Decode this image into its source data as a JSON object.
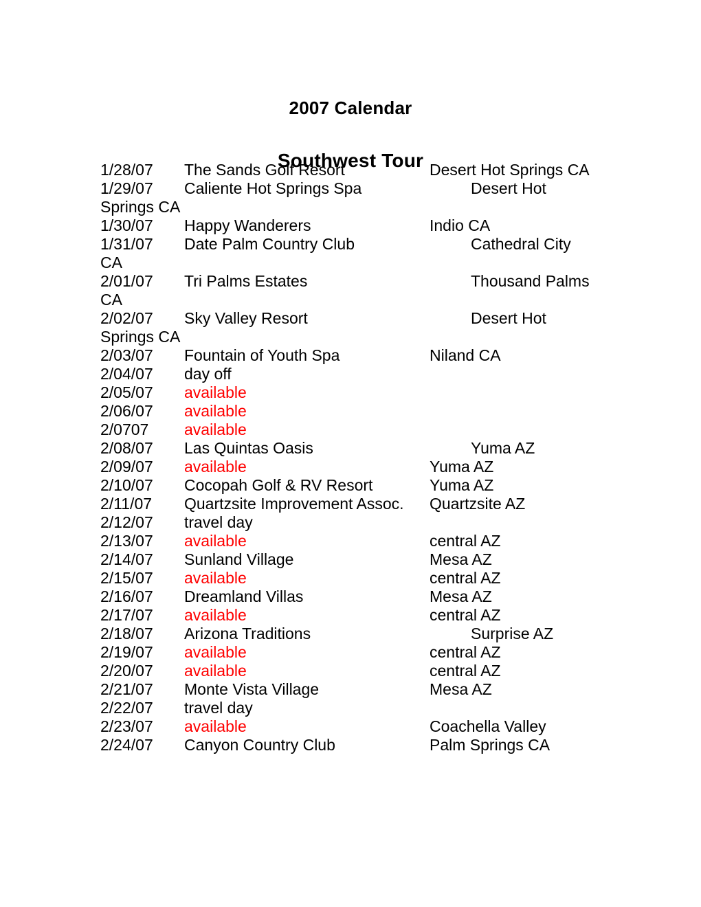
{
  "document": {
    "title": "2007 Calendar",
    "subtitle": "Southwest Tour"
  },
  "colors": {
    "available": "#ff0000",
    "text": "#000000",
    "background": "#ffffff"
  },
  "schedule": {
    "rows": [
      {
        "date": "1/28/07",
        "description": "The Sands Golf Resort",
        "available": false,
        "location": "Desert Hot Springs CA",
        "location_indent": 479,
        "wrap": ""
      },
      {
        "date": "1/29/07",
        "description": "Caliente Hot Springs Spa",
        "available": false,
        "location": "Desert Hot",
        "location_indent": 539,
        "wrap": "Springs CA"
      },
      {
        "date": "1/30/07",
        "description": "Happy Wanderers",
        "available": false,
        "location": "Indio CA",
        "location_indent": 479,
        "wrap": ""
      },
      {
        "date": "1/31/07",
        "description": "Date Palm Country Club",
        "available": false,
        "location": "Cathedral City",
        "location_indent": 539,
        "wrap": "CA"
      },
      {
        "date": "2/01/07",
        "description": "Tri Palms Estates",
        "available": false,
        "location": "Thousand Palms",
        "location_indent": 539,
        "wrap": "CA"
      },
      {
        "date": "2/02/07",
        "description": "Sky Valley Resort",
        "available": false,
        "location": "Desert Hot",
        "location_indent": 539,
        "wrap": "Springs CA"
      },
      {
        "date": "2/03/07",
        "description": "Fountain of Youth Spa",
        "available": false,
        "location": "Niland CA",
        "location_indent": 479,
        "wrap": ""
      },
      {
        "date": "2/04/07",
        "description": "day off",
        "available": false,
        "location": "",
        "location_indent": 479,
        "wrap": ""
      },
      {
        "date": "2/05/07",
        "description": "available",
        "available": true,
        "location": "",
        "location_indent": 479,
        "wrap": ""
      },
      {
        "date": "2/06/07",
        "description": "available",
        "available": true,
        "location": "",
        "location_indent": 479,
        "wrap": ""
      },
      {
        "date": "2/0707",
        "description": "available",
        "available": true,
        "location": "",
        "location_indent": 479,
        "wrap": ""
      },
      {
        "date": "2/08/07",
        "description": "Las Quintas Oasis",
        "available": false,
        "location": "Yuma AZ",
        "location_indent": 539,
        "wrap": ""
      },
      {
        "date": "2/09/07",
        "description": "available",
        "available": true,
        "location": "Yuma AZ",
        "location_indent": 479,
        "wrap": ""
      },
      {
        "date": "2/10/07",
        "description": "Cocopah Golf & RV Resort",
        "available": false,
        "location": "Yuma AZ",
        "location_indent": 479,
        "wrap": ""
      },
      {
        "date": "2/11/07",
        "description": "Quartzsite Improvement Assoc.",
        "available": false,
        "location": "Quartzsite AZ",
        "location_indent": 479,
        "wrap": ""
      },
      {
        "date": "2/12/07",
        "description": "travel day",
        "available": false,
        "location": "",
        "location_indent": 479,
        "wrap": ""
      },
      {
        "date": "2/13/07",
        "description": "available",
        "available": true,
        "location": "central AZ",
        "location_indent": 479,
        "wrap": ""
      },
      {
        "date": "2/14/07",
        "description": "Sunland Village",
        "available": false,
        "location": "Mesa AZ",
        "location_indent": 479,
        "wrap": ""
      },
      {
        "date": "2/15/07",
        "description": "available",
        "available": true,
        "location": "central AZ",
        "location_indent": 479,
        "wrap": ""
      },
      {
        "date": "2/16/07",
        "description": "Dreamland Villas",
        "available": false,
        "location": "Mesa AZ",
        "location_indent": 479,
        "wrap": ""
      },
      {
        "date": "2/17/07",
        "description": "available",
        "available": true,
        "location": "central AZ",
        "location_indent": 479,
        "wrap": ""
      },
      {
        "date": "2/18/07",
        "description": "Arizona Traditions",
        "available": false,
        "location": "Surprise AZ",
        "location_indent": 539,
        "wrap": ""
      },
      {
        "date": "2/19/07",
        "description": "available",
        "available": true,
        "location": "central AZ",
        "location_indent": 479,
        "wrap": ""
      },
      {
        "date": "2/20/07",
        "description": "available",
        "available": true,
        "location": "central AZ",
        "location_indent": 479,
        "wrap": ""
      },
      {
        "date": "2/21/07",
        "description": "Monte Vista Village",
        "available": false,
        "location": "Mesa AZ",
        "location_indent": 479,
        "wrap": ""
      },
      {
        "date": "2/22/07",
        "description": "travel day",
        "available": false,
        "location": "",
        "location_indent": 479,
        "wrap": ""
      },
      {
        "date": "2/23/07",
        "description": "available",
        "available": true,
        "location": "Coachella Valley",
        "location_indent": 479,
        "wrap": ""
      },
      {
        "date": "2/24/07",
        "description": "Canyon Country Club",
        "available": false,
        "location": "Palm Springs CA",
        "location_indent": 479,
        "wrap": ""
      }
    ]
  }
}
